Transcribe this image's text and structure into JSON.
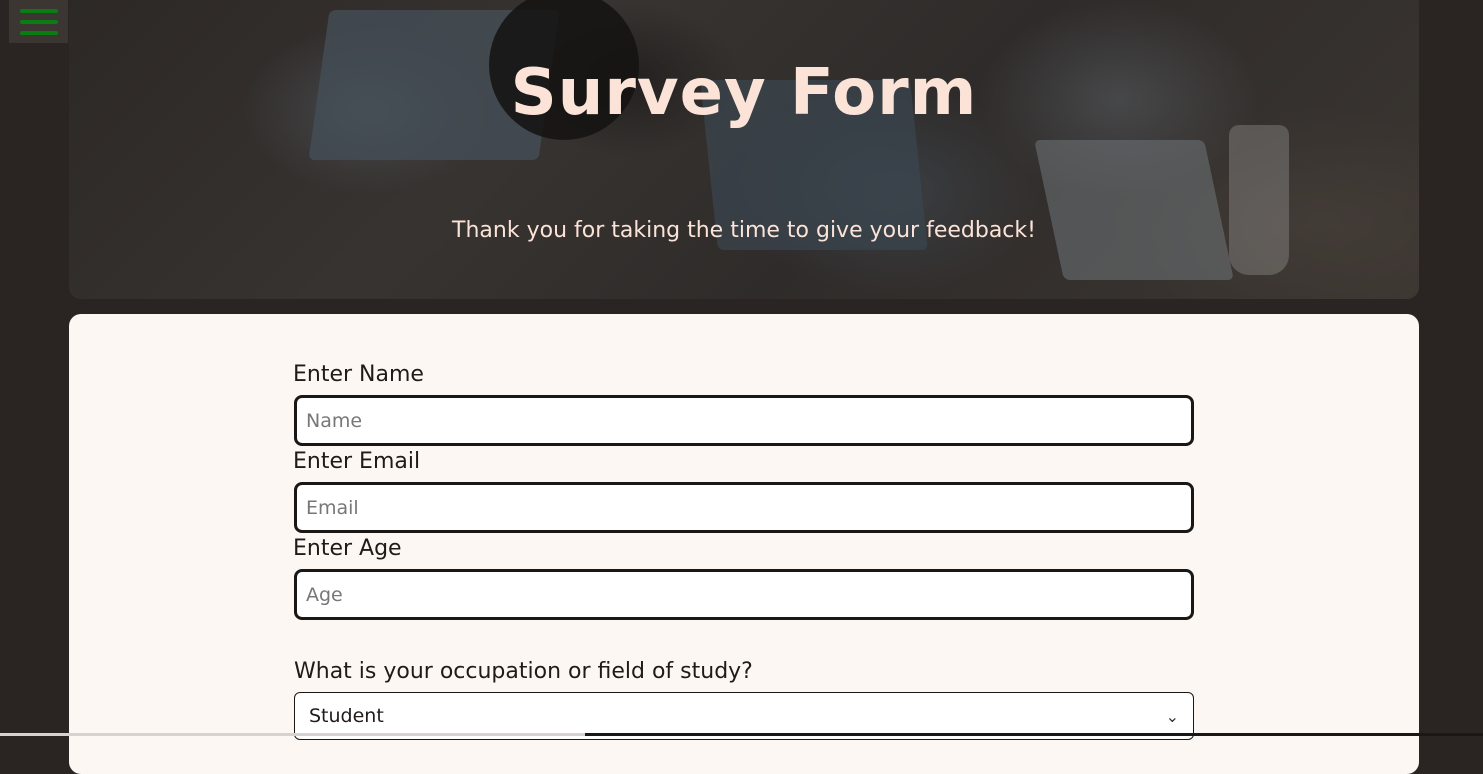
{
  "menu": {
    "icon": "hamburger-menu-icon",
    "color": "#0a7d12"
  },
  "hero": {
    "title": "Survey Form",
    "subtitle": "Thank you for taking the time to give your feedback!"
  },
  "form": {
    "name": {
      "label": "Enter Name",
      "placeholder": "Name",
      "value": ""
    },
    "email": {
      "label": "Enter Email",
      "placeholder": "Email",
      "value": ""
    },
    "age": {
      "label": "Enter Age",
      "placeholder": "Age",
      "value": ""
    },
    "occupation": {
      "label": "What is your occupation or field of study?",
      "selected": "Student",
      "icon": "chevron-down-icon"
    }
  },
  "colors": {
    "background": "#2a2522",
    "card": "#fdf7f3",
    "hero_text": "#fbe3d8"
  }
}
